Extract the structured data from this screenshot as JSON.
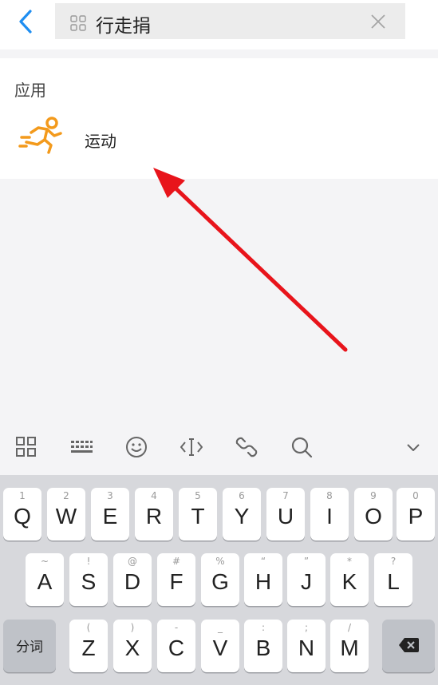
{
  "search": {
    "query": "行走捐"
  },
  "results": {
    "section_title": "应用",
    "items": [
      {
        "name": "运动",
        "icon": "running-person-icon",
        "icon_color": "#f39a1c"
      }
    ]
  },
  "keyboard_toolbar": {
    "icons": [
      "grid-icon",
      "keyboard-icon",
      "emoji-icon",
      "cursor-icon",
      "link-icon",
      "search-icon",
      "collapse-chevron-icon"
    ]
  },
  "keyboard": {
    "row1": [
      {
        "main": "Q",
        "hint": "1"
      },
      {
        "main": "W",
        "hint": "2"
      },
      {
        "main": "E",
        "hint": "3"
      },
      {
        "main": "R",
        "hint": "4"
      },
      {
        "main": "T",
        "hint": "5"
      },
      {
        "main": "Y",
        "hint": "6"
      },
      {
        "main": "U",
        "hint": "7"
      },
      {
        "main": "I",
        "hint": "8"
      },
      {
        "main": "O",
        "hint": "9"
      },
      {
        "main": "P",
        "hint": "0"
      }
    ],
    "row2": [
      {
        "main": "A",
        "hint": "~"
      },
      {
        "main": "S",
        "hint": "!"
      },
      {
        "main": "D",
        "hint": "@"
      },
      {
        "main": "F",
        "hint": "#"
      },
      {
        "main": "G",
        "hint": "%"
      },
      {
        "main": "H",
        "hint": "“"
      },
      {
        "main": "J",
        "hint": "”"
      },
      {
        "main": "K",
        "hint": "*"
      },
      {
        "main": "L",
        "hint": "?"
      }
    ],
    "row3": [
      {
        "main": "Z",
        "hint": "("
      },
      {
        "main": "X",
        "hint": ")"
      },
      {
        "main": "C",
        "hint": "-"
      },
      {
        "main": "V",
        "hint": "_"
      },
      {
        "main": "B",
        "hint": ":"
      },
      {
        "main": "N",
        "hint": ";"
      },
      {
        "main": "M",
        "hint": "/"
      }
    ],
    "fenci_label": "分词"
  },
  "colors": {
    "accent": "#1f8ef1",
    "arrow": "#e8141b"
  }
}
